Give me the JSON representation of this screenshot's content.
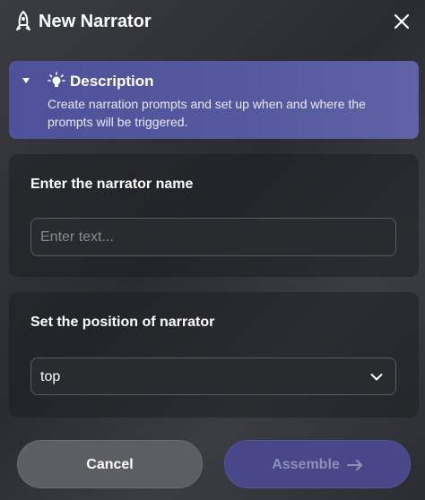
{
  "header": {
    "title": "New Narrator",
    "logo_icon": "rocket-icon",
    "close_icon": "close-icon"
  },
  "description": {
    "title": "Description",
    "text": "Create narration prompts and set up when and where the prompts will be triggered.",
    "expanded": true,
    "icon": "lightbulb-icon"
  },
  "name_section": {
    "label": "Enter the narrator name",
    "value": "",
    "placeholder": "Enter text..."
  },
  "position_section": {
    "label": "Set the position of narrator",
    "selected": "top"
  },
  "buttons": {
    "cancel": "Cancel",
    "assemble": "Assemble"
  },
  "colors": {
    "accent": "#5558a0",
    "button_disabled_text": "#8f8fb8"
  }
}
